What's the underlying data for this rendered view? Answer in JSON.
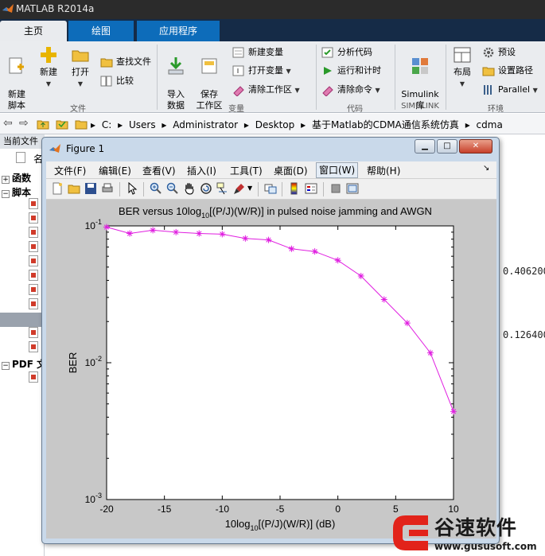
{
  "app": {
    "title": "MATLAB R2014a"
  },
  "ribbon": {
    "tabs": [
      "主页",
      "绘图",
      "应用程序"
    ],
    "file": {
      "new_script": "新建\n脚本",
      "new": "新建",
      "open": "打开",
      "find_files": "查找文件",
      "compare": "比较",
      "group": "文件"
    },
    "variable": {
      "import_data": "导入\n数据",
      "save_workspace": "保存\n工作区",
      "new_variable": "新建变量",
      "open_variable": "打开变量",
      "clear_workspace": "清除工作区",
      "group": "变量"
    },
    "code": {
      "analyze_code": "分析代码",
      "run_and_time": "运行和计时",
      "clear_commands": "清除命令",
      "group": "代码"
    },
    "simulink": {
      "library": "Simulink\n库",
      "group": "SIMULINK"
    },
    "environment": {
      "layout": "布局",
      "preferences": "预设",
      "set_path": "设置路径",
      "parallel": "Parallel",
      "group": "环境"
    }
  },
  "address": {
    "path": [
      "C:",
      "Users",
      "Administrator",
      "Desktop",
      "基于Matlab的CDMA通信系统仿真",
      "cdma"
    ]
  },
  "left_panel": {
    "header": "当前文件",
    "col": "名",
    "sections": [
      "函数",
      "脚本",
      "PDF 文"
    ]
  },
  "right_panel": {
    "values": [
      "0.406200",
      "0.126400"
    ]
  },
  "figure": {
    "title": "Figure 1",
    "menu": [
      "文件(F)",
      "编辑(E)",
      "查看(V)",
      "插入(I)",
      "工具(T)",
      "桌面(D)",
      "窗口(W)",
      "帮助(H)"
    ],
    "toolbar_icons": [
      "new-figure-icon",
      "open-file-icon",
      "save-icon",
      "print-icon",
      "pointer-icon",
      "zoom-in-icon",
      "zoom-out-icon",
      "pan-hand-icon",
      "rotate-3d-icon",
      "data-cursor-icon",
      "brush-icon",
      "link-plot-icon",
      "colorbar-icon",
      "legend-icon",
      "hide-plot-tools-icon",
      "show-plot-tools-icon"
    ]
  },
  "chart_data": {
    "type": "line",
    "title_prefix": "BER versus 10log",
    "title_sub": "10",
    "title_suffix": "[(P/J)(W/R)] in pulsed noise jamming and AWGN",
    "xlabel_prefix": "10log",
    "xlabel_sub": "10",
    "xlabel_suffix": "[(P/J)(W/R)] (dB)",
    "ylabel": "BER",
    "xlim": [
      -20,
      10
    ],
    "ylim": [
      0.001,
      0.1
    ],
    "yscale": "log",
    "xticks": [
      "-20",
      "-15",
      "-10",
      "-5",
      "0",
      "5",
      "10"
    ],
    "yticks": [
      {
        "base": "10",
        "exp": "-1"
      },
      {
        "base": "10",
        "exp": "-2"
      },
      {
        "base": "10",
        "exp": "-3"
      }
    ],
    "marker": "asterisk",
    "color": "#e01ee0",
    "series": [
      {
        "x": [
          -20,
          -18,
          -16,
          -14,
          -12,
          -10,
          -8,
          -6,
          -4,
          -2,
          0,
          2,
          4,
          6,
          8,
          10
        ],
        "y": [
          0.098,
          0.088,
          0.093,
          0.09,
          0.088,
          0.087,
          0.081,
          0.079,
          0.068,
          0.065,
          0.056,
          0.043,
          0.029,
          0.0195,
          0.0118,
          0.0044
        ]
      }
    ]
  },
  "watermark": {
    "brand": "谷速软件",
    "url": "www.gususoft.com"
  }
}
